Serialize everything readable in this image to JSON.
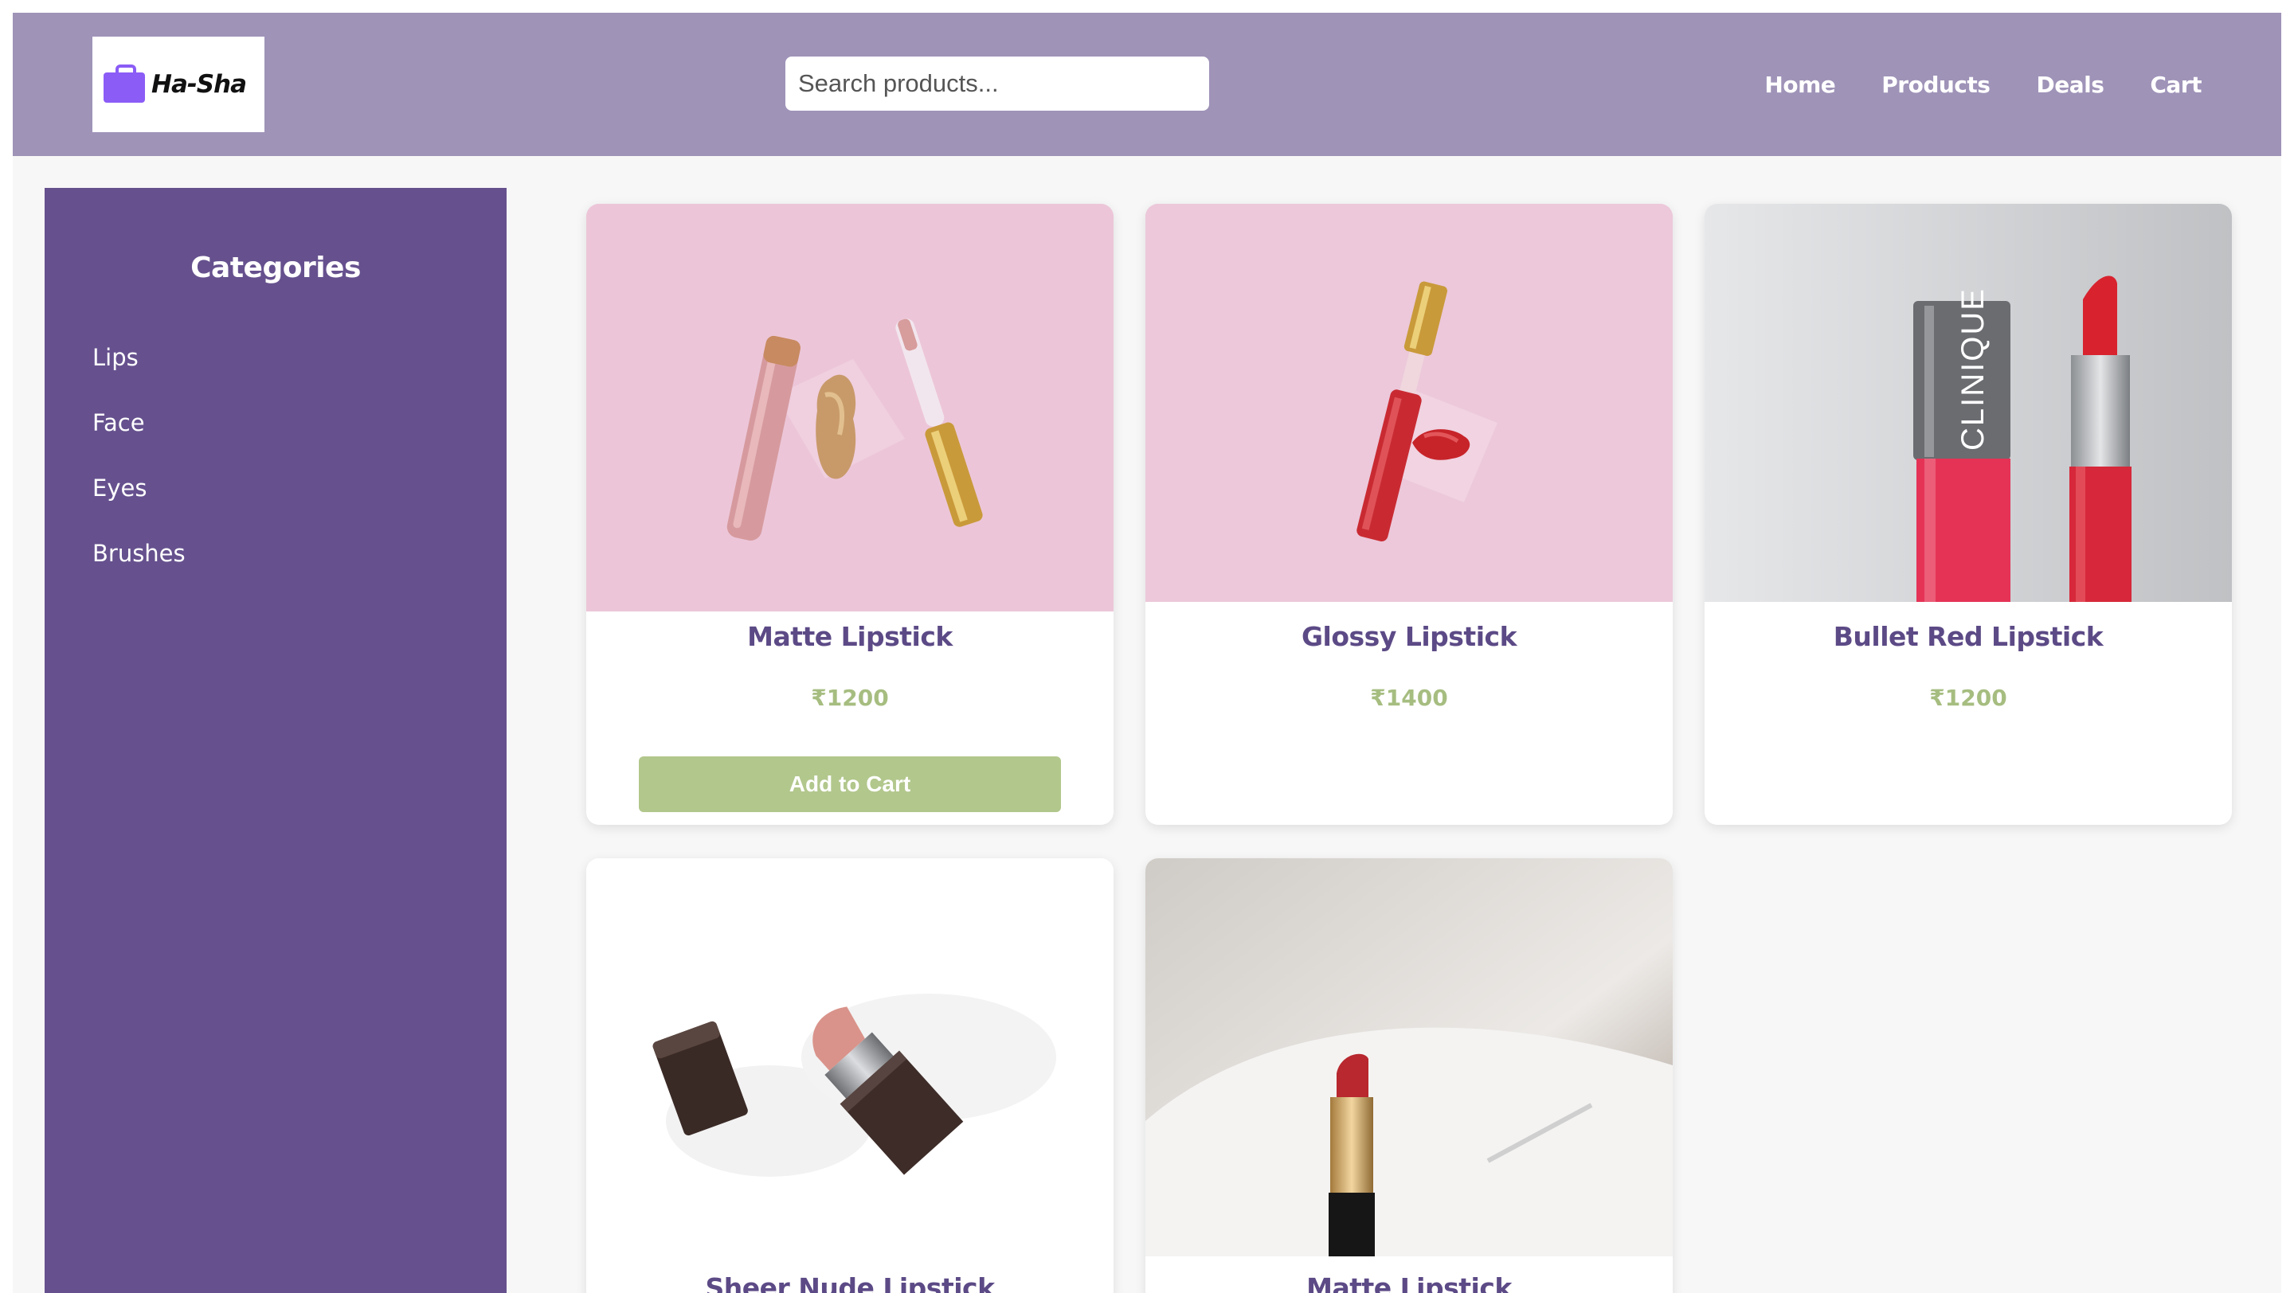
{
  "header": {
    "logo_text": "Ha-Sha",
    "search_placeholder": "Search products...",
    "nav": [
      "Home",
      "Products",
      "Deals",
      "Cart"
    ]
  },
  "sidebar": {
    "title": "Categories",
    "items": [
      "Lips",
      "Face",
      "Eyes",
      "Brushes"
    ]
  },
  "products": [
    {
      "name": "Matte Lipstick",
      "price": "₹1200",
      "button": "Add to Cart"
    },
    {
      "name": "Glossy Lipstick",
      "price": "₹1400"
    },
    {
      "name": "Bullet Red Lipstick",
      "price": "₹1200"
    },
    {
      "name": "Sheer Nude Lipstick"
    },
    {
      "name": "Matte Lipstick"
    }
  ],
  "colors": {
    "header_bg": "#9f93b8",
    "sidebar_bg": "#66518e",
    "product_name": "#5c4a86",
    "price": "#a6bd80",
    "button": "#b2c78c"
  }
}
